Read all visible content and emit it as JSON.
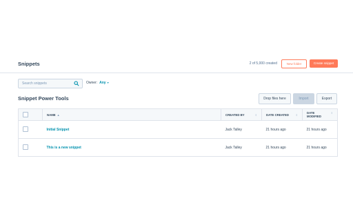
{
  "header": {
    "title": "Snippets",
    "count_text": "2 of 5,000 created",
    "new_folder_label": "New folder",
    "create_label": "Create snippet"
  },
  "filters": {
    "search_placeholder": "Search snippets",
    "owner_label": "Owner:",
    "owner_value": "Any"
  },
  "section": {
    "title": "Snippet Power Tools",
    "drop_label": "Drop files here",
    "import_label": "Import",
    "export_label": "Export"
  },
  "table": {
    "columns": [
      "NAME",
      "CREATED BY",
      "DATE CREATED",
      "DATE MODIFIED"
    ],
    "rows": [
      {
        "name": "Initial Snippet",
        "created_by": "Jack Talley",
        "date_created": "21 hours ago",
        "date_modified": "21 hours ago"
      },
      {
        "name": "This is a new snippet",
        "created_by": "Jack Talley",
        "date_created": "21 hours ago",
        "date_modified": "21 hours ago"
      }
    ]
  },
  "colors": {
    "accent": "#ff7a59",
    "link": "#0091ae",
    "text": "#33475b"
  }
}
